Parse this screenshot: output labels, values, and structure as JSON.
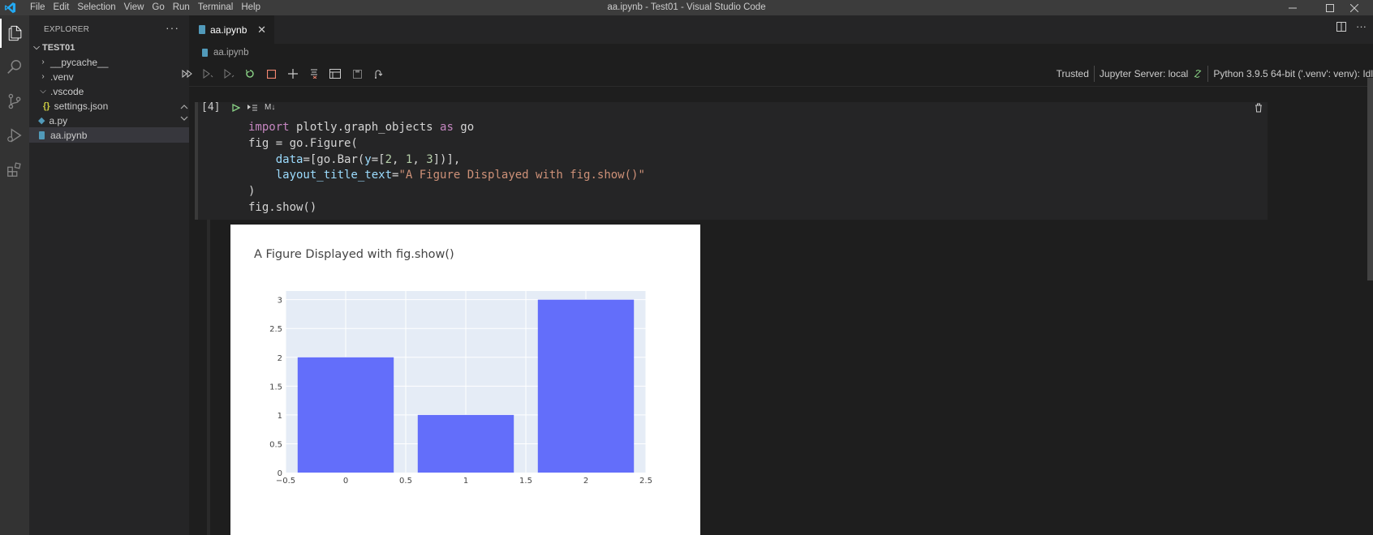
{
  "window": {
    "title": "aa.ipynb - Test01 - Visual Studio Code",
    "menu": [
      "File",
      "Edit",
      "Selection",
      "View",
      "Go",
      "Run",
      "Terminal",
      "Help"
    ]
  },
  "activity_bar": [
    "files-icon",
    "search-icon",
    "source-control-icon",
    "run-debug-icon",
    "extensions-icon"
  ],
  "explorer": {
    "header": "EXPLORER",
    "more": "···",
    "root": "TEST01",
    "items": [
      {
        "label": "__pycache__",
        "type": "folder",
        "expanded": false
      },
      {
        "label": ".venv",
        "type": "folder",
        "expanded": false
      },
      {
        "label": ".vscode",
        "type": "folder",
        "expanded": true
      },
      {
        "label": "settings.json",
        "type": "json"
      },
      {
        "label": "a.py",
        "type": "python"
      },
      {
        "label": "aa.ipynb",
        "type": "notebook",
        "selected": true
      }
    ]
  },
  "tabs": [
    {
      "label": "aa.ipynb",
      "active": true
    }
  ],
  "breadcrumb": "aa.ipynb",
  "notebook_toolbar": {
    "trusted": "Trusted",
    "jupyter_server": "Jupyter Server: local",
    "kernel": "Python 3.9.5 64-bit ('.venv': venv): Idl"
  },
  "cell": {
    "execution_count": "[4]",
    "cell_type_badge": "M↓",
    "code": {
      "l1_kw": "import",
      "l1_mod": " plotly.graph_objects ",
      "l1_as": "as",
      "l1_go": " go",
      "l2": "fig = go.Figure(",
      "l3_indent": "    ",
      "l3_param": "data",
      "l3_a": "=[go.Bar(",
      "l3_y": "y",
      "l3_b": "=[",
      "l3_n1": "2",
      "l3_c1": ", ",
      "l3_n2": "1",
      "l3_c2": ", ",
      "l3_n3": "3",
      "l3_end": "])],",
      "l4_indent": "    ",
      "l4_param": "layout_title_text",
      "l4_eq": "=",
      "l4_str": "\"A Figure Displayed with fig.show()\"",
      "l5": ")",
      "l6": "fig.show()"
    }
  },
  "chart_data": {
    "type": "bar",
    "title": "A Figure Displayed with fig.show()",
    "x": [
      0,
      1,
      2
    ],
    "values": [
      2,
      1,
      3
    ],
    "xlim": [
      -0.5,
      2.5
    ],
    "ylim": [
      0,
      3.15
    ],
    "xticks": [
      "−0.5",
      "0",
      "0.5",
      "1",
      "1.5",
      "2",
      "2.5"
    ],
    "xtick_values": [
      -0.5,
      0,
      0.5,
      1,
      1.5,
      2,
      2.5
    ],
    "yticks": [
      "0",
      "0.5",
      "1",
      "1.5",
      "2",
      "2.5",
      "3"
    ],
    "ytick_values": [
      0,
      0.5,
      1,
      1.5,
      2,
      2.5,
      3
    ],
    "bar_color": "#636efa",
    "plot_bg": "#e5ecf6",
    "grid": true
  },
  "colors": {
    "accent": "#007acc",
    "notebook_icon": "#519aba",
    "python_icon": "#519aba",
    "json_icon": "#cbcb41"
  }
}
